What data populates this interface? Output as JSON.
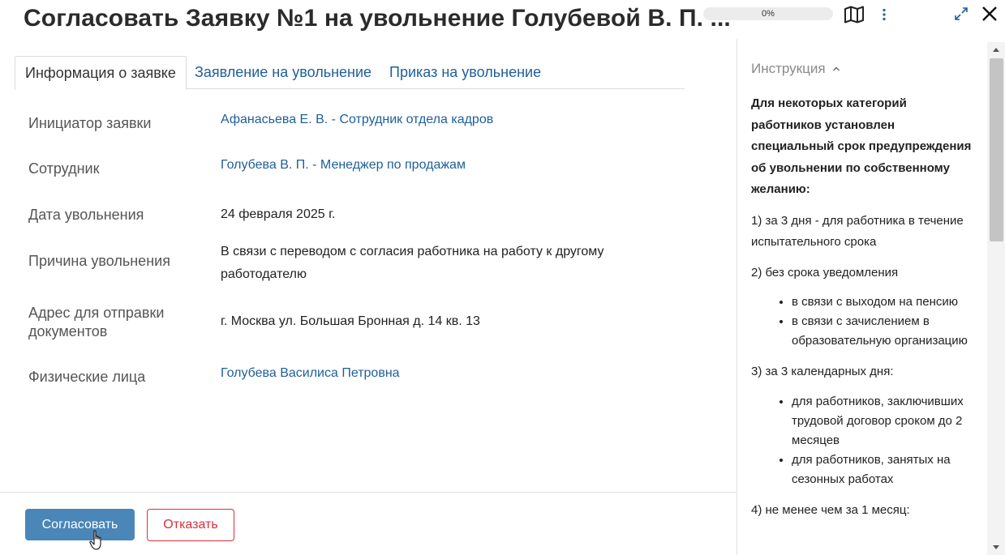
{
  "header": {
    "title": "Согласовать Заявку №1 на увольнение Голубевой В. П. ...",
    "progress_text": "0%",
    "progress_value": 0,
    "icons": [
      "map-icon",
      "more-vertical-icon",
      "expand-icon",
      "close-icon"
    ]
  },
  "tabs": [
    {
      "label": "Информация о заявке",
      "active": true
    },
    {
      "label": "Заявление на увольнение",
      "active": false
    },
    {
      "label": "Приказ на увольнение",
      "active": false
    }
  ],
  "fields": [
    {
      "label": "Инициатор заявки",
      "value": "Афанасьева Е. В. - Сотрудник отдела кадров",
      "link": true
    },
    {
      "label": "Сотрудник",
      "value": "Голубева В. П. - Менеджер по продажам",
      "link": true
    },
    {
      "label": "Дата увольнения",
      "value": "24 февраля 2025 г.",
      "link": false
    },
    {
      "label": "Причина увольнения",
      "value": "В связи с переводом с согласия работника на работу к другому работодателю",
      "link": false
    },
    {
      "label": "Адрес для отправки документов",
      "value": "г. Москва ул. Большая Бронная д. 14 кв. 13",
      "link": false
    },
    {
      "label": "Физические лица",
      "value": "Голубева Василиса Петровна",
      "link": true
    }
  ],
  "actions": {
    "approve_label": "Согласовать",
    "reject_label": "Отказать"
  },
  "instruction": {
    "header": "Инструкция",
    "intro": "Для некоторых категорий работников установлен специальный срок предупреждения об увольнении по собственному желанию:",
    "item1": "1) за 3 дня - для работника в течение испытательного срока",
    "item2": "2) без срока уведомления",
    "item2_bullets": [
      "в связи с выходом на пенсию",
      "в связи с зачислением в образовательную организацию"
    ],
    "item3": "3) за 3 календарных дня:",
    "item3_bullets": [
      "для работников, заключивших трудовой договор сроком до 2 месяцев",
      "для работников, занятых на сезонных работах"
    ],
    "item4": "4) не менее чем за 1 месяц:"
  },
  "colors": {
    "accent": "#4a86b8",
    "link": "#1f5f98",
    "danger": "#d8313b"
  }
}
